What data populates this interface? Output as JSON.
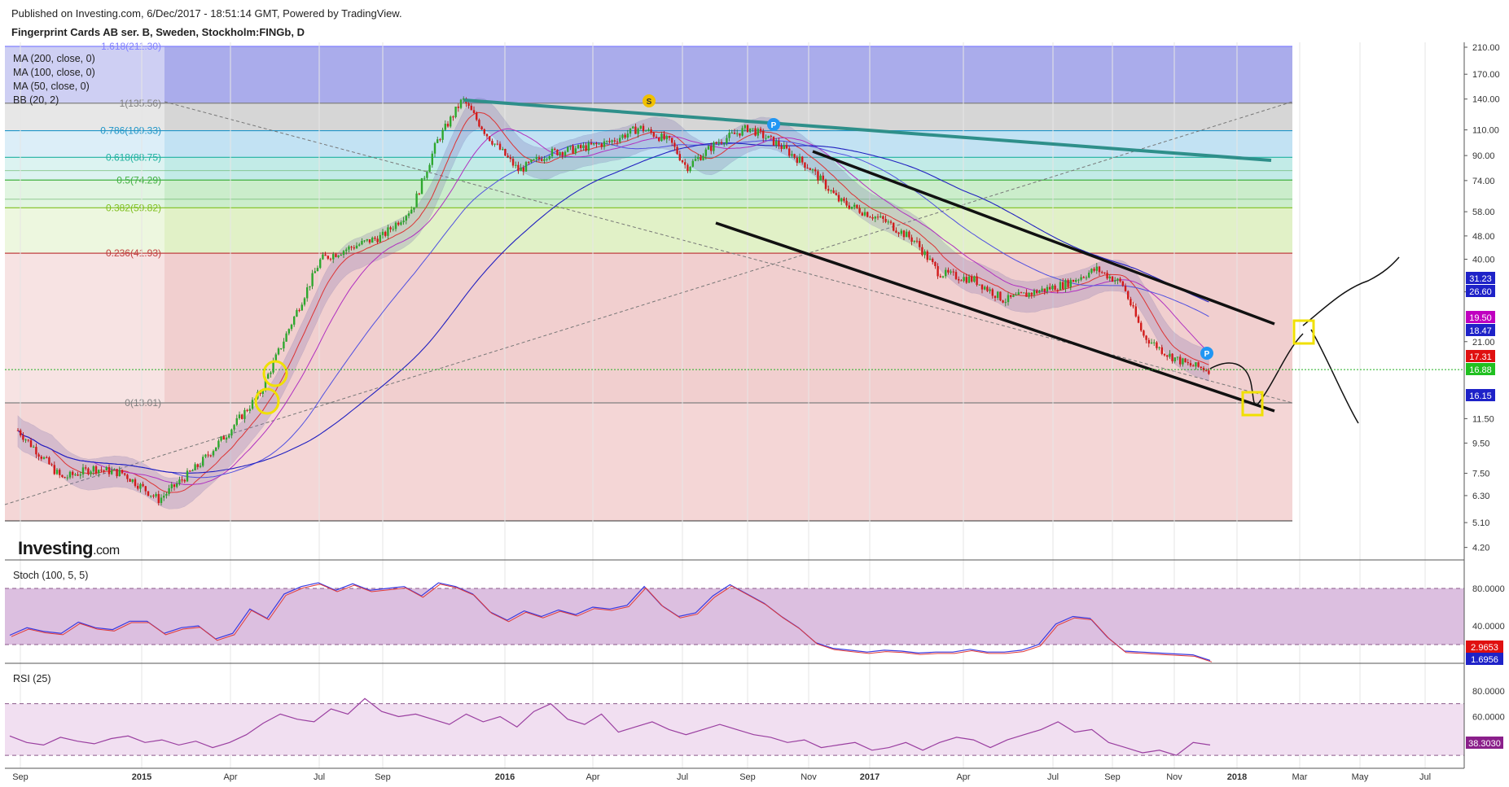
{
  "header": {
    "published": "Published on Investing.com, 6/Dec/2017 - 18:51:14 GMT, Powered by TradingView.",
    "symbol": "Fingerprint Cards AB ser. B, Sweden, Stockholm:FINGb, D"
  },
  "indicators": [
    "MA (200, close, 0)",
    "MA (100, close, 0)",
    "MA (50, close, 0)",
    "BB (20, 2)"
  ],
  "logo": {
    "main": "Investing",
    "suffix": ".com"
  },
  "chart_data": [
    {
      "type": "candlestick",
      "title": "Fingerprint Cards AB ser. B, Sweden, Stockholm:FINGb, D",
      "x_ticks": [
        "Sep",
        "2015",
        "Apr",
        "Jul",
        "Sep",
        "2016",
        "Apr",
        "Jul",
        "Sep",
        "Nov",
        "2017",
        "Apr",
        "Jul",
        "Sep",
        "Nov",
        "2018",
        "Mar",
        "May",
        "Jul"
      ],
      "y_scale": "log",
      "y_ticks": [
        "210.00",
        "170.00",
        "140.00",
        "110.00",
        "90.00",
        "74.00",
        "58.00",
        "48.00",
        "40.00",
        "31.00",
        "21.00",
        "11.50",
        "9.50",
        "7.50",
        "6.30",
        "5.10",
        "4.20"
      ],
      "price_badges": [
        {
          "value": "31.23",
          "color": "#1e22c8"
        },
        {
          "value": "26.60",
          "color": "#1e22c8"
        },
        {
          "value": "19.50",
          "color": "#c000c0"
        },
        {
          "value": "18.47",
          "color": "#1e22c8"
        },
        {
          "value": "17.31",
          "color": "#e01010"
        },
        {
          "value": "16.88",
          "color": "#20c020"
        },
        {
          "value": "16.15",
          "color": "#1e22c8"
        }
      ],
      "fibonacci": [
        {
          "label": "1.618(211.30)",
          "level": 1.618,
          "price": 211.3,
          "color": "#8080ff"
        },
        {
          "label": "1(135.56)",
          "level": 1,
          "price": 135.56,
          "color": "#808080"
        },
        {
          "label": "0.786(109.33)",
          "level": 0.786,
          "price": 109.33,
          "color": "#2196c8"
        },
        {
          "label": "0.618(88.75)",
          "level": 0.618,
          "price": 88.75,
          "color": "#20b2a0"
        },
        {
          "label": "0.5(74.29)",
          "level": 0.5,
          "price": 74.29,
          "color": "#40b040"
        },
        {
          "label": "0.382(59.82)",
          "level": 0.382,
          "price": 59.82,
          "color": "#80c020"
        },
        {
          "label": "0.236(41.93)",
          "level": 0.236,
          "price": 41.93,
          "color": "#c04040"
        },
        {
          "label": "0(13.01)",
          "level": 0,
          "price": 13.01,
          "color": "#808080"
        }
      ],
      "markers": [
        {
          "text": "S",
          "color": "#f0c000"
        },
        {
          "text": "P",
          "color": "#2196f3"
        },
        {
          "text": "P",
          "color": "#2196f3"
        }
      ],
      "close_series": [
        {
          "date": "2014-09-01",
          "close": 10.5
        },
        {
          "date": "2014-10-15",
          "close": 7.2
        },
        {
          "date": "2014-11-15",
          "close": 7.8
        },
        {
          "date": "2014-12-15",
          "close": 7.5
        },
        {
          "date": "2015-01-20",
          "close": 6.1
        },
        {
          "date": "2015-03-01",
          "close": 8.0
        },
        {
          "date": "2015-04-01",
          "close": 10.5
        },
        {
          "date": "2015-05-01",
          "close": 14.0
        },
        {
          "date": "2015-06-01",
          "close": 24.0
        },
        {
          "date": "2015-07-01",
          "close": 40.0
        },
        {
          "date": "2015-08-01",
          "close": 44.0
        },
        {
          "date": "2015-09-01",
          "close": 48.0
        },
        {
          "date": "2015-10-01",
          "close": 60.0
        },
        {
          "date": "2015-10-25",
          "close": 100.0
        },
        {
          "date": "2015-11-20",
          "close": 140.0
        },
        {
          "date": "2015-12-15",
          "close": 105.0
        },
        {
          "date": "2016-01-15",
          "close": 80.0
        },
        {
          "date": "2016-02-15",
          "close": 92.0
        },
        {
          "date": "2016-03-15",
          "close": 95.0
        },
        {
          "date": "2016-04-15",
          "close": 100.0
        },
        {
          "date": "2016-05-15",
          "close": 112.0
        },
        {
          "date": "2016-06-15",
          "close": 100.0
        },
        {
          "date": "2016-07-01",
          "close": 82.0
        },
        {
          "date": "2016-08-01",
          "close": 100.0
        },
        {
          "date": "2016-09-01",
          "close": 112.0
        },
        {
          "date": "2016-10-01",
          "close": 98.0
        },
        {
          "date": "2016-11-01",
          "close": 82.0
        },
        {
          "date": "2016-12-01",
          "close": 63.0
        },
        {
          "date": "2017-01-15",
          "close": 54.0
        },
        {
          "date": "2017-02-15",
          "close": 46.0
        },
        {
          "date": "2017-03-10",
          "close": 36.0
        },
        {
          "date": "2017-04-15",
          "close": 34.0
        },
        {
          "date": "2017-05-15",
          "close": 29.0
        },
        {
          "date": "2017-06-15",
          "close": 31.0
        },
        {
          "date": "2017-07-15",
          "close": 33.0
        },
        {
          "date": "2017-08-15",
          "close": 37.0
        },
        {
          "date": "2017-09-10",
          "close": 33.0
        },
        {
          "date": "2017-10-01",
          "close": 22.0
        },
        {
          "date": "2017-10-25",
          "close": 19.0
        },
        {
          "date": "2017-11-15",
          "close": 17.5
        },
        {
          "date": "2017-12-06",
          "close": 16.88
        }
      ]
    },
    {
      "type": "line",
      "title": "Stoch (100, 5, 5)",
      "y_ticks": [
        "80.0000",
        "40.0000"
      ],
      "bands": [
        80,
        20
      ],
      "badges": [
        {
          "value": "2.9653",
          "color": "#e01010"
        },
        {
          "value": "1.6956",
          "color": "#1e22c8"
        }
      ],
      "series": [
        {
          "values": [
            30,
            38,
            34,
            32,
            44,
            38,
            36,
            45,
            45,
            32,
            38,
            40,
            26,
            32,
            58,
            48,
            74,
            82,
            86,
            78,
            85,
            78,
            80,
            82,
            72,
            86,
            82,
            74,
            55,
            46,
            56,
            50,
            57,
            52,
            60,
            58,
            62,
            82,
            62,
            50,
            54,
            72,
            84,
            74,
            64,
            50,
            38,
            22,
            16,
            14,
            12,
            14,
            13,
            11,
            12,
            12,
            15,
            12,
            12,
            14,
            20,
            42,
            50,
            48,
            28,
            13,
            12,
            11,
            10,
            9,
            3
          ]
        }
      ]
    },
    {
      "type": "line",
      "title": "RSI (25)",
      "y_ticks": [
        "80.0000",
        "60.0000"
      ],
      "bands": [
        70,
        30
      ],
      "badges": [
        {
          "value": "38.3030",
          "color": "#8a1f8a"
        }
      ],
      "series": [
        {
          "values": [
            45,
            40,
            38,
            44,
            41,
            39,
            43,
            45,
            40,
            42,
            38,
            41,
            36,
            40,
            46,
            55,
            62,
            58,
            56,
            66,
            62,
            74,
            64,
            60,
            62,
            58,
            54,
            62,
            56,
            60,
            52,
            64,
            70,
            58,
            54,
            62,
            48,
            52,
            56,
            50,
            46,
            50,
            54,
            50,
            46,
            44,
            40,
            42,
            36,
            38,
            40,
            34,
            36,
            40,
            34,
            40,
            44,
            42,
            36,
            42,
            46,
            50,
            56,
            48,
            50,
            40,
            36,
            32,
            34,
            30,
            40,
            38
          ]
        }
      ]
    }
  ]
}
